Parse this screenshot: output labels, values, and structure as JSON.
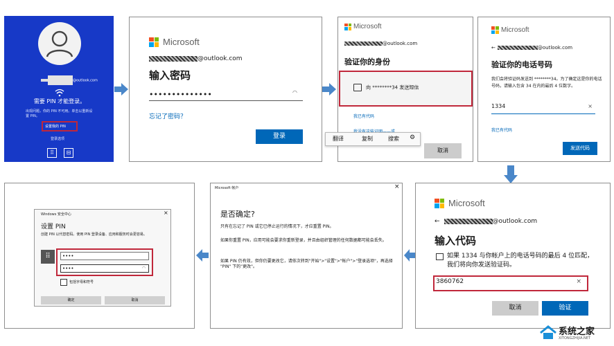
{
  "colors": {
    "accent": "#0067b8",
    "arrow": "#4a87c9",
    "red": "#c0273a",
    "lock_bg": "#1739c7"
  },
  "p1": {
    "email_suffix": "@outlook.com",
    "message": "需要 PIN 才能登录。",
    "detail": "出现问题，你的 PIN 不可用。单击以重新设置 PIN。",
    "reset_link": "设置我的 PIN",
    "signin_options": "登录选项"
  },
  "p2": {
    "brand": "Microsoft",
    "email": "@outlook.com",
    "title": "输入密码",
    "password": "••••••••••••••",
    "forgot": "忘记了密码？",
    "signin": "登录"
  },
  "p3": {
    "brand": "Microsoft",
    "email": "@outlook.com",
    "title": "验证你的身份",
    "option": "向 ********34 发送短信",
    "have_code": "我已有代码",
    "no_access": "我没有这些证明——或",
    "context_menu": [
      "翻译",
      "复制",
      "搜索"
    ],
    "cancel": "取消"
  },
  "p4": {
    "brand": "Microsoft",
    "email": "@outlook.com",
    "title": "验证你的电话号码",
    "desc": "我们会将验证码发送到 ********34。为了确定这是你的电话号码，请输入包含 34 在内的最后 4 位数字。",
    "input": "1334",
    "clear": "×",
    "have_code": "我已有代码",
    "send": "发送代码"
  },
  "p5": {
    "brand": "Microsoft",
    "email": "@outlook.com",
    "title": "输入代码",
    "desc": "如果 1334 与你帐户上的电话号码的最后 4 位匹配，我们将向你发送验证码。",
    "code": "3860762",
    "clear": "×",
    "cancel": "取消",
    "verify": "验证"
  },
  "p6": {
    "window_title": "Microsoft 帐户",
    "close": "×",
    "title": "是否确定?",
    "para1": "只有在忘记了 PIN 或它已停止运行的情况下，才应重置 PIN。",
    "para2": "如果你重置 PIN，应用可能会要求你重新登录，并且由组织管理的任何数据都可能会丢失。",
    "para3": "如果 PIN 仍有效，但你仍要更改它，请依次转到\"开始\">\"设置\">\"帐户\">\"登录选项\"，再选择 \"PIN\" 下的\"更改\"。"
  },
  "p7": {
    "window_title": "Windows 安全中心",
    "close": "×",
    "title": "设置 PIN",
    "desc": "创建 PIN 以代替密码。使用 PIN 登录设备、应用和服务时会更容易。",
    "pin1": "••••",
    "pin2": "••••",
    "checkbox": "包括字母和符号",
    "ok": "确定",
    "cancel": "取消"
  },
  "watermark": {
    "name": "系统之家",
    "url": "XITONGZHIJIA.NET"
  }
}
